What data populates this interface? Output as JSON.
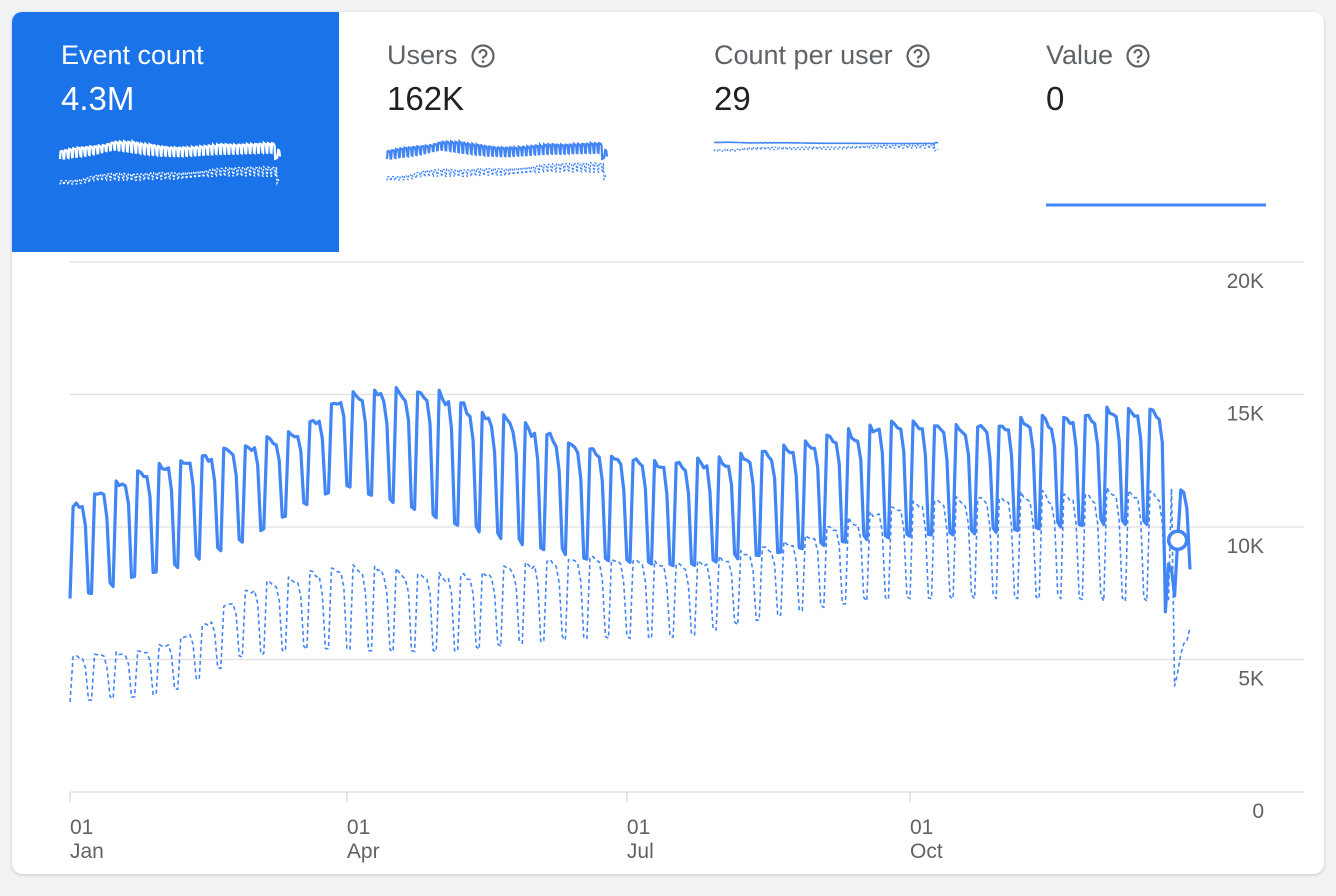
{
  "metrics": [
    {
      "label": "Event count",
      "value": "4.3M",
      "has_help": false,
      "selected": true
    },
    {
      "label": "Users",
      "value": "162K",
      "has_help": true,
      "selected": false
    },
    {
      "label": "Count per user",
      "value": "29",
      "has_help": true,
      "selected": false
    },
    {
      "label": "Value",
      "value": "0",
      "has_help": true,
      "selected": false
    }
  ],
  "icons": {
    "help": "help-circle-icon"
  },
  "colors": {
    "accent": "#1a73e8",
    "series": "#4285f4",
    "grid": "#e0e0e0",
    "tick": "#5f6368"
  },
  "chart_data": {
    "type": "line",
    "x_axis": {
      "type": "date",
      "start": "Jan 01",
      "end": "Dec 31",
      "tick_labels": [
        {
          "day": "01",
          "month": "Jan"
        },
        {
          "day": "01",
          "month": "Apr"
        },
        {
          "day": "01",
          "month": "Jul"
        },
        {
          "day": "01",
          "month": "Oct"
        }
      ]
    },
    "y_axis": {
      "ticks": [
        "0",
        "5K",
        "10K",
        "15K",
        "20K"
      ],
      "ylim": [
        0,
        20000
      ],
      "position": "right"
    },
    "grid": true,
    "legend": "none",
    "series": [
      {
        "style": "solid",
        "weekday_peak_weekly": [
          10900,
          11600,
          12300,
          12700,
          12900,
          13200,
          13500,
          14000,
          15200,
          15300,
          15400,
          15200,
          14500,
          14200,
          13700,
          13200,
          12800,
          12600,
          12600,
          12700,
          12900,
          13200,
          13500,
          13800,
          14200,
          14100,
          13900,
          14000,
          14200,
          14300,
          14500,
          14600
        ],
        "weekend_trough_weekly": [
          7300,
          7600,
          8200,
          8400,
          8900,
          9400,
          10200,
          10900,
          11600,
          11100,
          10700,
          10200,
          9800,
          9400,
          9100,
          8800,
          8700,
          8600,
          8500,
          8700,
          8900,
          9100,
          9300,
          9500,
          9600,
          9700,
          9700,
          9800,
          9900,
          10000,
          10100,
          10100
        ],
        "end_values": [
          6800,
          8600,
          8400,
          7400,
          9500,
          11400,
          11300,
          10700,
          8400
        ]
      },
      {
        "style": "dashed",
        "weekday_peak_weekly": [
          5200,
          5300,
          5400,
          5800,
          6500,
          7700,
          8100,
          8400,
          8700,
          8600,
          8400,
          8300,
          8400,
          8700,
          8900,
          9000,
          8900,
          8800,
          8700,
          9000,
          9300,
          9600,
          10100,
          10600,
          11000,
          11200,
          11200,
          11300,
          11400,
          11400,
          11500,
          11500
        ],
        "weekend_trough_weekly": [
          3400,
          3500,
          3600,
          3800,
          4400,
          5100,
          5300,
          5400,
          5400,
          5300,
          5300,
          5300,
          5400,
          5600,
          5700,
          5800,
          5800,
          5800,
          5900,
          6200,
          6500,
          6800,
          7000,
          7200,
          7300,
          7300,
          7300,
          7300,
          7300,
          7300,
          7200,
          7200
        ],
        "end_values": [
          4000,
          4500,
          5200,
          5600,
          5700,
          6200
        ]
      }
    ]
  }
}
